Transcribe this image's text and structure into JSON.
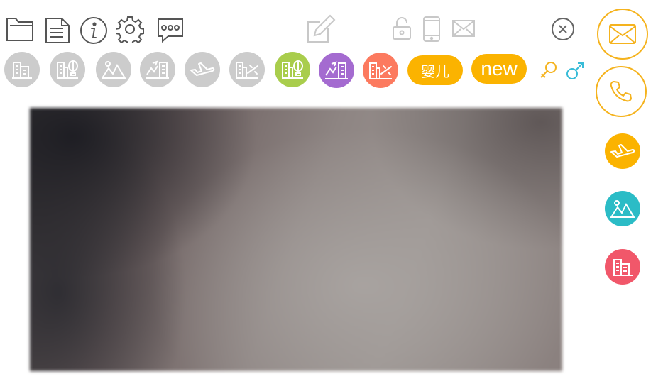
{
  "toolbar": {
    "icons": [
      "folder-icon",
      "document-icon",
      "info-icon",
      "gear-icon",
      "chat-icon",
      "edit-icon",
      "unlock-icon",
      "phone-device-icon",
      "mail-icon",
      "close-icon"
    ]
  },
  "category_row": {
    "pills": {
      "baby_label": "婴儿",
      "new_label": "new"
    },
    "colors": {
      "gray": "#cccccc",
      "green": "#a9cd4c",
      "purple": "#a46bd0",
      "coral": "#fc7a5f",
      "yellow": "#fbb300",
      "female": "#f5b31e",
      "male": "#38bcd8"
    }
  },
  "side_menu": {
    "colors": {
      "ring": "#f5b31e",
      "plane": "#fbb300",
      "scenery": "#2bbcc6",
      "hotel": "#f1576a"
    }
  },
  "photo": {
    "icon": "photo-placeholder"
  }
}
